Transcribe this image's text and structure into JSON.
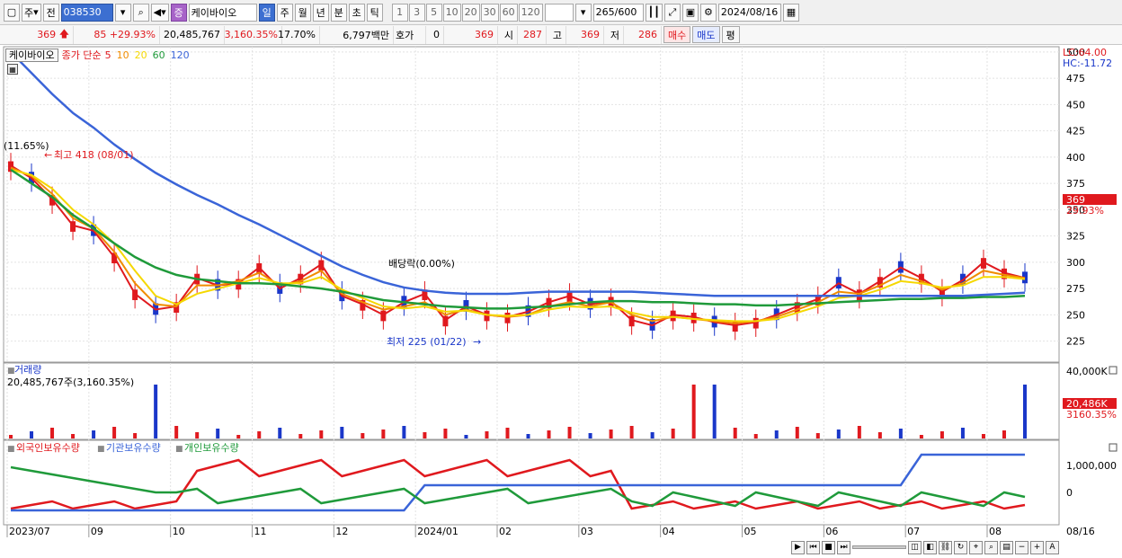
{
  "toolbar": {
    "type_label": "주",
    "prev_label": "전",
    "code": "038530",
    "stock_name": "케이바이오",
    "period_tabs": [
      {
        "label": "일",
        "active": true
      },
      {
        "label": "주",
        "active": false
      },
      {
        "label": "월",
        "active": false
      },
      {
        "label": "년",
        "active": false
      },
      {
        "label": "분",
        "active": false
      },
      {
        "label": "초",
        "active": false
      },
      {
        "label": "틱",
        "active": false
      }
    ],
    "intervals": [
      "1",
      "3",
      "5",
      "10",
      "20",
      "30",
      "60",
      "120"
    ],
    "count": "265",
    "count_max": "/600",
    "date": "2024/08/16"
  },
  "quote": {
    "price": "369",
    "change": "85",
    "change_pct": "+29.93%",
    "volume": "20,485,767",
    "volume_pct": "3,160.35%",
    "turnover": "17.70%",
    "amount": "6,797백만",
    "hoga_label": "호가",
    "hoga_value": "0",
    "hoga_price": "369",
    "open_label": "시",
    "open": "287",
    "high_label": "고",
    "high": "369",
    "low_label": "저",
    "low": "286",
    "buy_label": "매수",
    "sell_label": "매도",
    "avg_label": "평"
  },
  "legend": {
    "name": "케이바이오",
    "series_label": "종가 단순",
    "ma": [
      {
        "label": "5",
        "color": "#e0191e"
      },
      {
        "label": "10",
        "color": "#f08c00"
      },
      {
        "label": "20",
        "color": "#f5d800"
      },
      {
        "label": "60",
        "color": "#1f9a3a"
      },
      {
        "label": "120",
        "color": "#3a64d8"
      }
    ]
  },
  "annotations": {
    "lc": "LC:64.00",
    "hc": "HC:-11.72",
    "left_pct": "(11.65%)",
    "high_mark": "최고 418 (08/01)",
    "dividend": "배당락(0.00%)",
    "low_mark": "최저 225 (01/22)",
    "price_tag": "369",
    "price_tag_pct": "29.93%",
    "vol_tag": "20,486K",
    "vol_tag_pct": "3160.35%"
  },
  "volume_panel": {
    "title": "거래량",
    "summary": "20,485,767주(3,160.35%)",
    "axis_max": "40,000K"
  },
  "holdings_panel": {
    "legend": [
      {
        "label": "외국인보유수량",
        "color": "#e0191e"
      },
      {
        "label": "기관보유수량",
        "color": "#3a64d8"
      },
      {
        "label": "개인보유수량",
        "color": "#1f9a3a"
      }
    ],
    "ticks": [
      "1,000,000",
      "0"
    ]
  },
  "x_axis": {
    "labels": [
      "2023/07",
      "09",
      "10",
      "11",
      "12",
      "2024/01",
      "02",
      "03",
      "04",
      "05",
      "06",
      "07",
      "08"
    ],
    "right_label": "08/16"
  },
  "colors": {
    "candle_up": "#e0191e",
    "candle_down": "#1a37c9",
    "grid": "#e2e2e2"
  },
  "chart_data": {
    "type": "line",
    "title": "",
    "y_ticks": [
      225,
      250,
      275,
      300,
      325,
      350,
      375,
      400,
      425,
      450,
      475,
      500
    ],
    "ylim": [
      205,
      505
    ],
    "x": [
      "2023/07",
      "09",
      "10",
      "11",
      "12",
      "2024/01",
      "02",
      "03",
      "04",
      "05",
      "06",
      "07",
      "08"
    ],
    "series": [
      {
        "name": "5",
        "values": [
          392,
          380,
          360,
          335,
          330,
          305,
          270,
          255,
          258,
          285,
          278,
          280,
          295,
          275,
          285,
          298,
          268,
          260,
          250,
          262,
          270,
          245,
          258,
          250,
          248,
          253,
          262,
          268,
          260,
          263,
          245,
          240,
          250,
          248,
          243,
          240,
          243,
          250,
          258,
          265,
          280,
          270,
          282,
          295,
          285,
          272,
          283,
          300,
          290,
          285
        ]
      },
      {
        "name": "10",
        "values": [
          390,
          382,
          365,
          342,
          332,
          310,
          280,
          260,
          258,
          278,
          278,
          282,
          290,
          278,
          282,
          292,
          270,
          262,
          255,
          258,
          262,
          250,
          255,
          250,
          248,
          250,
          258,
          262,
          258,
          262,
          250,
          244,
          248,
          246,
          244,
          242,
          244,
          248,
          255,
          262,
          272,
          270,
          278,
          288,
          282,
          274,
          280,
          292,
          288,
          285
        ]
      },
      {
        "name": "20",
        "values": [
          388,
          383,
          370,
          350,
          336,
          318,
          292,
          268,
          260,
          270,
          275,
          280,
          285,
          280,
          280,
          286,
          274,
          266,
          258,
          256,
          258,
          253,
          254,
          250,
          249,
          250,
          255,
          258,
          257,
          258,
          252,
          248,
          248,
          246,
          245,
          244,
          244,
          246,
          252,
          258,
          266,
          268,
          274,
          282,
          280,
          276,
          278,
          286,
          286,
          284
        ]
      },
      {
        "name": "60",
        "values": [
          388,
          375,
          362,
          345,
          332,
          318,
          305,
          295,
          288,
          284,
          282,
          280,
          280,
          279,
          277,
          275,
          272,
          268,
          264,
          262,
          260,
          258,
          257,
          256,
          256,
          257,
          258,
          260,
          262,
          263,
          263,
          262,
          262,
          261,
          260,
          260,
          259,
          259,
          260,
          261,
          262,
          263,
          264,
          265,
          265,
          266,
          266,
          267,
          267,
          268
        ]
      },
      {
        "name": "120",
        "values": [
          500,
          480,
          460,
          442,
          428,
          412,
          398,
          385,
          374,
          364,
          355,
          345,
          336,
          326,
          316,
          306,
          296,
          288,
          281,
          276,
          273,
          271,
          270,
          270,
          270,
          271,
          272,
          272,
          272,
          272,
          272,
          271,
          270,
          269,
          268,
          268,
          268,
          268,
          268,
          268,
          268,
          268,
          268,
          268,
          268,
          268,
          268,
          269,
          270,
          271
        ]
      }
    ]
  }
}
